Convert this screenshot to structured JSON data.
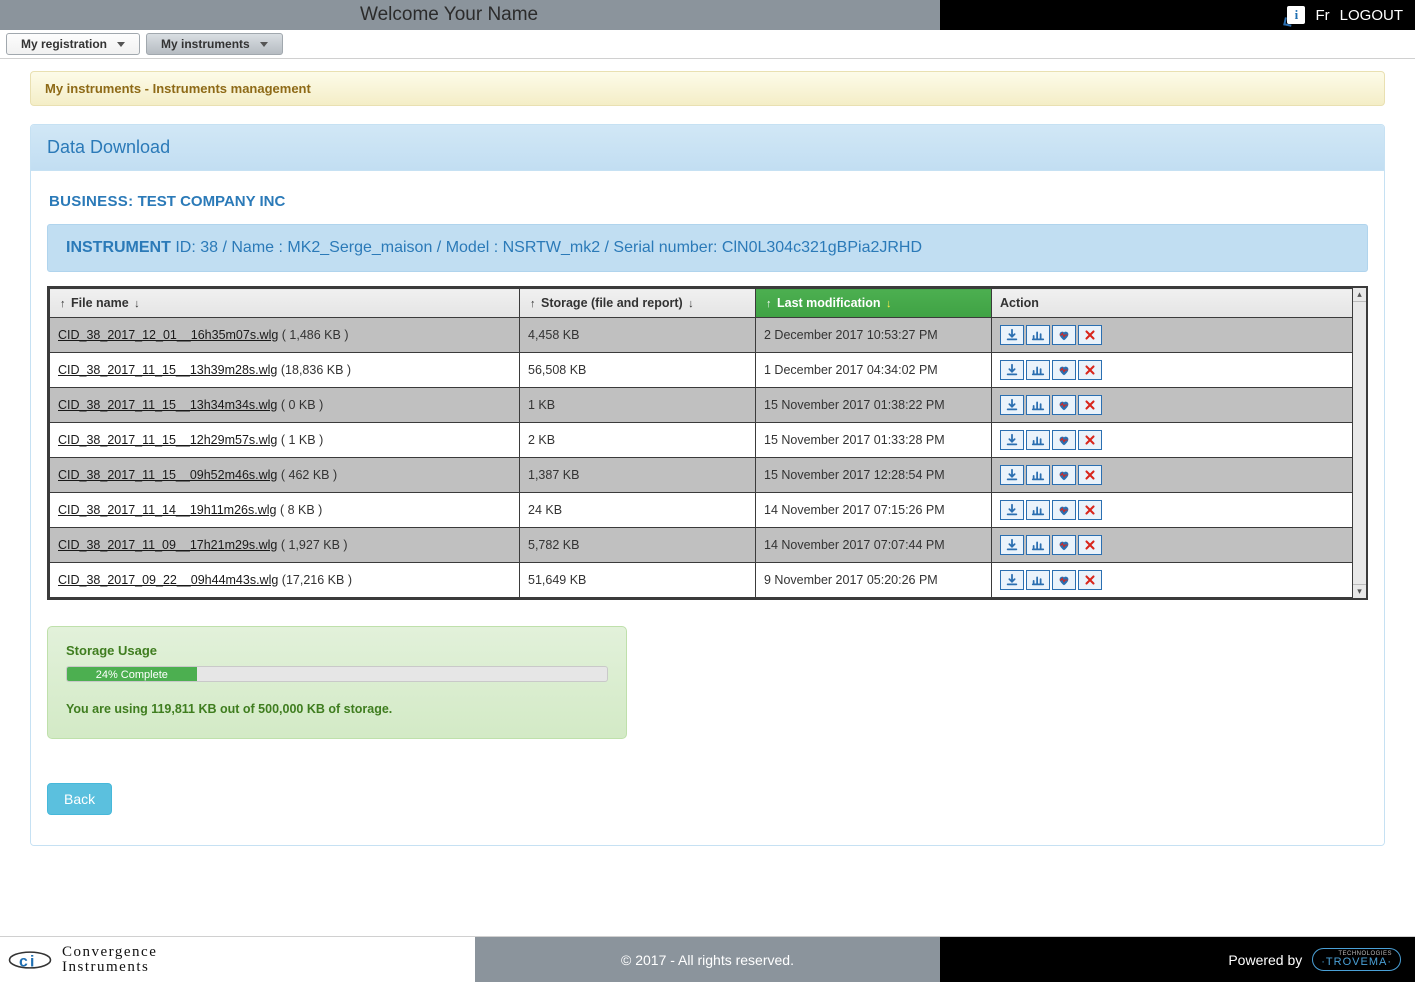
{
  "header": {
    "welcome": "Welcome  Your Name",
    "lang": "Fr",
    "logout": "LOGOUT"
  },
  "nav": {
    "registration": "My registration",
    "instruments": "My instruments"
  },
  "breadcrumb": "My instruments - Instruments management",
  "panel_title": "Data Download",
  "business": {
    "label": "BUSINESS:",
    "value": "TEST COMPANY INC"
  },
  "instrument": {
    "label": "INSTRUMENT",
    "details": "ID: 38 / Name : MK2_Serge_maison / Model : NSRTW_mk2 / Serial number: ClN0L304c321gBPia2JRHD"
  },
  "columns": {
    "file": "File name",
    "storage": "Storage (file and report)",
    "modified": "Last modification",
    "action": "Action"
  },
  "rows": [
    {
      "name": "CID_38_2017_12_01__16h35m07s.wlg",
      "size": "( 1,486 KB )",
      "storage": "4,458 KB",
      "modified": "2 December 2017 10:53:27 PM"
    },
    {
      "name": "CID_38_2017_11_15__13h39m28s.wlg",
      "size": "(18,836 KB )",
      "storage": "56,508 KB",
      "modified": "1 December 2017 04:34:02 PM"
    },
    {
      "name": "CID_38_2017_11_15__13h34m34s.wlg",
      "size": "( 0 KB )",
      "storage": "1 KB",
      "modified": "15 November 2017 01:38:22 PM"
    },
    {
      "name": "CID_38_2017_11_15__12h29m57s.wlg",
      "size": "( 1 KB )",
      "storage": "2 KB",
      "modified": "15 November 2017 01:33:28 PM"
    },
    {
      "name": "CID_38_2017_11_15__09h52m46s.wlg",
      "size": "( 462 KB )",
      "storage": "1,387 KB",
      "modified": "15 November 2017 12:28:54 PM"
    },
    {
      "name": "CID_38_2017_11_14__19h11m26s.wlg",
      "size": "( 8 KB )",
      "storage": "24 KB",
      "modified": "14 November 2017 07:15:26 PM"
    },
    {
      "name": "CID_38_2017_11_09__17h21m29s.wlg",
      "size": "( 1,927 KB )",
      "storage": "5,782 KB",
      "modified": "14 November 2017 07:07:44 PM"
    },
    {
      "name": "CID_38_2017_09_22__09h44m43s.wlg",
      "size": "(17,216 KB )",
      "storage": "51,649 KB",
      "modified": "9 November 2017 05:20:26 PM"
    }
  ],
  "storage_box": {
    "title": "Storage Usage",
    "percent_label": "24% Complete",
    "percent": 24,
    "note": "You are using 119,811 KB out of 500,000 KB of storage."
  },
  "back": "Back",
  "footer": {
    "company_l1": "Convergence",
    "company_l2": "Instruments",
    "copyright": "© 2017 - All rights reserved.",
    "powered": "Powered by",
    "trovema_small": "TECHNOLOGIES",
    "trovema": "·TROVEMA·"
  }
}
